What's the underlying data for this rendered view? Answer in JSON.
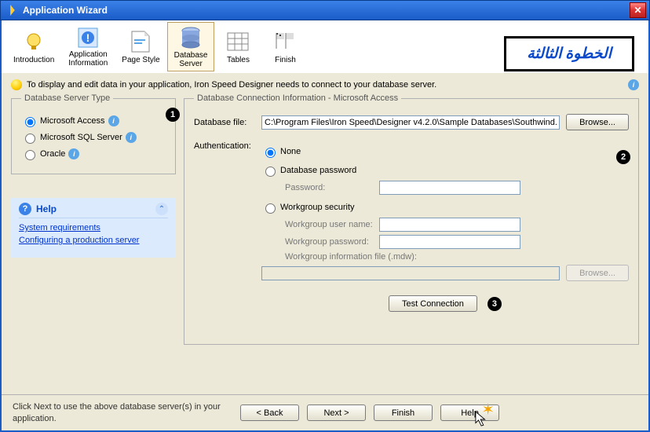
{
  "title": "Application Wizard",
  "overlay_text": "الخطوة الثالثة",
  "toolbar": {
    "items": [
      {
        "label": "Introduction",
        "icon": "bulb-icon"
      },
      {
        "label": "Application\nInformation",
        "icon": "info-square-icon"
      },
      {
        "label": "Page Style",
        "icon": "page-icon"
      },
      {
        "label": "Database\nServer",
        "icon": "database-icon"
      },
      {
        "label": "Tables",
        "icon": "tables-icon"
      },
      {
        "label": "Finish",
        "icon": "flags-icon"
      }
    ],
    "selected_index": 3
  },
  "info_strip": "To display and edit data in your application, Iron Speed Designer needs to connect to your database server.",
  "server_type": {
    "legend": "Database Server Type",
    "options": [
      "Microsoft Access",
      "Microsoft SQL Server",
      "Oracle"
    ],
    "selected": "Microsoft Access"
  },
  "connection": {
    "legend": "Database Connection Information - Microsoft Access",
    "db_file_label": "Database file:",
    "db_file_value": "C:\\Program Files\\Iron Speed\\Designer v4.2.0\\Sample Databases\\Southwind.m",
    "browse_label": "Browse...",
    "auth_label": "Authentication:",
    "auth_options": {
      "none": "None",
      "dbpass": "Database password",
      "wg": "Workgroup security"
    },
    "password_label": "Password:",
    "wg_user_label": "Workgroup user name:",
    "wg_pass_label": "Workgroup password:",
    "wg_file_label": "Workgroup information file (.mdw):",
    "test_button": "Test Connection",
    "browse2_label": "Browse..."
  },
  "help": {
    "title": "Help",
    "links": [
      "System requirements",
      "Configuring a production server"
    ]
  },
  "footer": {
    "text": "Click Next to use the above database server(s) in your application.",
    "back": "< Back",
    "next": "Next >",
    "finish": "Finish",
    "help": "Help"
  }
}
